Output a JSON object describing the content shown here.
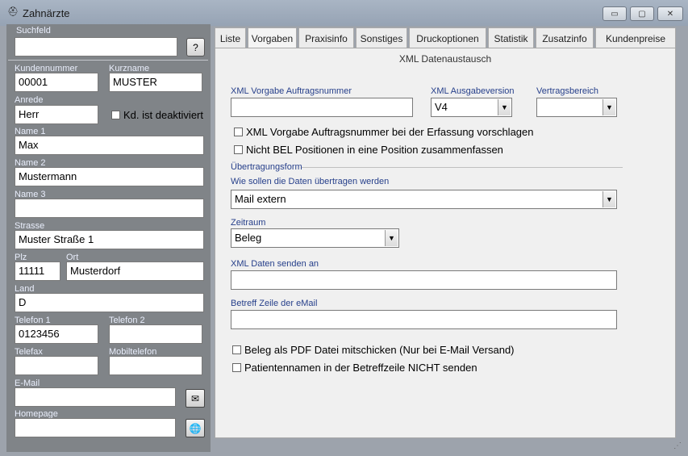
{
  "window": {
    "title": "Zahnärzte"
  },
  "left": {
    "suchfeld_label": "Suchfeld",
    "suchfeld_value": "",
    "help_button": "?",
    "kundennummer_label": "Kundennummer",
    "kundennummer_value": "00001",
    "kurzname_label": "Kurzname",
    "kurzname_value": "MUSTER",
    "anrede_label": "Anrede",
    "anrede_value": "Herr",
    "deaktiviert_label": "Kd. ist deaktiviert",
    "name1_label": "Name 1",
    "name1_value": "Max",
    "name2_label": "Name 2",
    "name2_value": "Mustermann",
    "name3_label": "Name 3",
    "name3_value": "",
    "strasse_label": "Strasse",
    "strasse_value": "Muster Straße 1",
    "plz_label": "Plz",
    "plz_value": "11111",
    "ort_label": "Ort",
    "ort_value": "Musterdorf",
    "land_label": "Land",
    "land_value": "D",
    "telefon1_label": "Telefon 1",
    "telefon1_value": "0123456",
    "telefon2_label": "Telefon 2",
    "telefon2_value": "",
    "telefax_label": "Telefax",
    "telefax_value": "",
    "mobil_label": "Mobiltelefon",
    "mobil_value": "",
    "email_label": "E-Mail",
    "email_value": "",
    "homepage_label": "Homepage",
    "homepage_value": ""
  },
  "tabs": [
    "Liste",
    "Vorgaben",
    "Praxisinfo",
    "Sonstiges",
    "Druckoptionen",
    "Statistik",
    "Zusatzinfo",
    "Kundenpreise"
  ],
  "active_tab": "Vorgaben",
  "main": {
    "section_title": "XML Datenaustausch",
    "auftragsnummer_label": "XML Vorgabe Auftragsnummer",
    "auftragsnummer_value": "",
    "ausgabeversion_label": "XML Ausgabeversion",
    "ausgabeversion_value": "V4",
    "vertragsbereich_label": "Vertragsbereich",
    "vertragsbereich_value": "",
    "cb_vorschlagen": "XML Vorgabe Auftragsnummer bei der Erfassung vorschlagen",
    "cb_bel": "Nicht BEL Positionen in eine Position zusammenfassen",
    "uebertragungsform_label": "Übertragungsform",
    "uebertragen_label": "Wie sollen die Daten übertragen werden",
    "uebertragen_value": "Mail extern",
    "zeitraum_label": "Zeitraum",
    "zeitraum_value": "Beleg",
    "senden_label": "XML Daten senden an",
    "senden_value": "",
    "betreff_label": "Betreff Zeile der eMail",
    "betreff_value": "",
    "cb_pdf": "Beleg als PDF Datei mitschicken (Nur bei E-Mail Versand)",
    "cb_patient": "Patientennamen in der Betreffzeile NICHT senden"
  }
}
